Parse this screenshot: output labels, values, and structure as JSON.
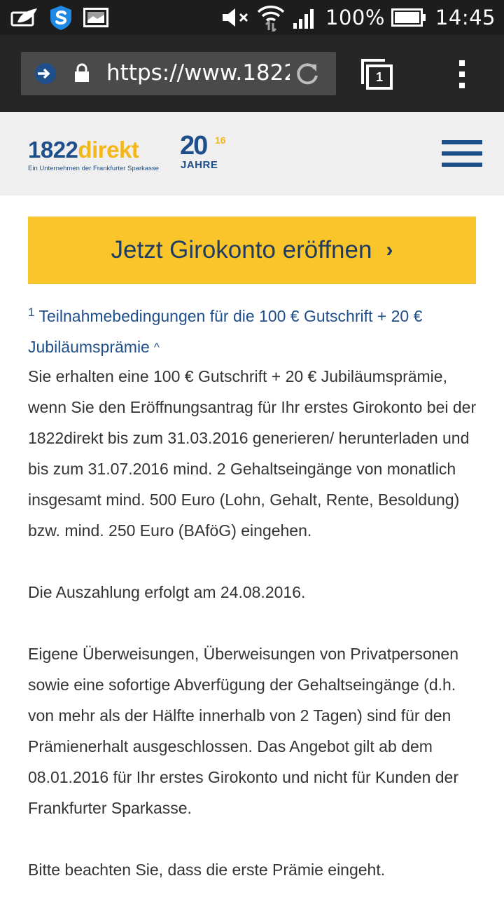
{
  "status_bar": {
    "battery_percent": "100%",
    "time": "14:45"
  },
  "browser": {
    "url": "https://www.1822...",
    "tab_count": "1"
  },
  "site": {
    "logo_main_part1": "1822",
    "logo_main_part2": "direkt",
    "logo_subtitle": "Ein Unternehmen der Frankfurter Sparkasse",
    "anniversary_number": "20",
    "anniversary_superscript": "16",
    "anniversary_label": "JAHRE"
  },
  "content": {
    "cta_label": "Jetzt Girokonto eröffnen",
    "terms_footnote_marker": "1",
    "terms_heading": "Teilnahmebedingungen für die 100 € Gutschrift + 20 € Jubiläumsprämie",
    "paragraphs": [
      "Sie erhalten eine 100 € Gutschrift + 20 € Jubiläumsprämie, wenn Sie den Eröffnungsantrag für Ihr erstes Girokonto bei der 1822direkt bis zum 31.03.2016 generieren/ herunterladen und bis zum 31.07.2016 mind. 2 Gehaltseingänge von monatlich insgesamt mind. 500 Euro (Lohn, Gehalt, Rente, Besoldung) bzw. mind. 250 Euro (BAföG) eingehen.",
      "Die Auszahlung erfolgt am 24.08.2016.",
      "Eigene Überweisungen, Überweisungen von Privatpersonen sowie eine sofortige Abverfügung der Gehaltseingänge (d.h. von mehr als der Hälfte innerhalb von 2 Tagen) sind für den Prämienerhalt ausgeschlossen. Das Angebot gilt ab dem 08.01.2016 für Ihr erstes Girokonto und nicht für Kunden der Frankfurter Sparkasse.",
      "Bitte beachten Sie, dass die erste Prämie eingeht."
    ]
  },
  "colors": {
    "brand_blue": "#1f4f8b",
    "brand_yellow": "#f4b717",
    "cta_yellow": "#fac52a",
    "status_bar_bg": "#1d1d1d",
    "browser_bar_bg": "#262626"
  },
  "icons": {
    "status_left": [
      "notification-icon",
      "vpn-shield-icon",
      "image-icon"
    ],
    "status_right": [
      "mute-icon",
      "wifi-icon",
      "signal-icon",
      "battery-icon"
    ],
    "browser": [
      "site-icon",
      "lock-icon",
      "reload-icon",
      "tabs-icon",
      "menu-dots-icon"
    ],
    "site": [
      "hamburger-menu-icon",
      "chevron-right-icon",
      "chevron-up-icon"
    ]
  }
}
